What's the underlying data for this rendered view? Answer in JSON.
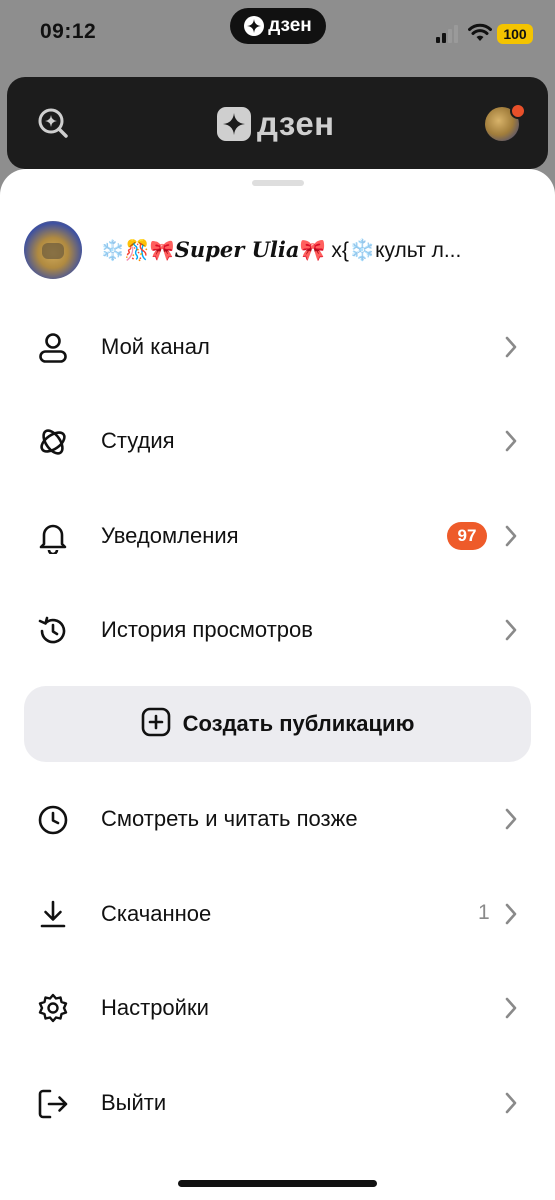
{
  "status_bar": {
    "time": "09:12",
    "island_label": "дзен",
    "battery": "100"
  },
  "header": {
    "logo_text": "дзен",
    "icons": [
      "search-icon",
      "avatar"
    ]
  },
  "profile": {
    "prefix_emoji": "❄️🎊🎀",
    "name": "Super Ulia",
    "suffix": "🎀 x{❄️культ л..."
  },
  "menu": {
    "my_channel": "Мой канал",
    "studio": "Студия",
    "notifications": "Уведомления",
    "notifications_badge": "97",
    "history": "История просмотров",
    "create_label": "Создать публикацию",
    "watch_later": "Смотреть и читать позже",
    "downloads": "Скачанное",
    "downloads_count": "1",
    "settings": "Настройки",
    "logout": "Выйти"
  },
  "colors": {
    "accent_badge": "#ee5b2a",
    "battery": "#f4c400",
    "header_bg": "#1c1c1c"
  }
}
